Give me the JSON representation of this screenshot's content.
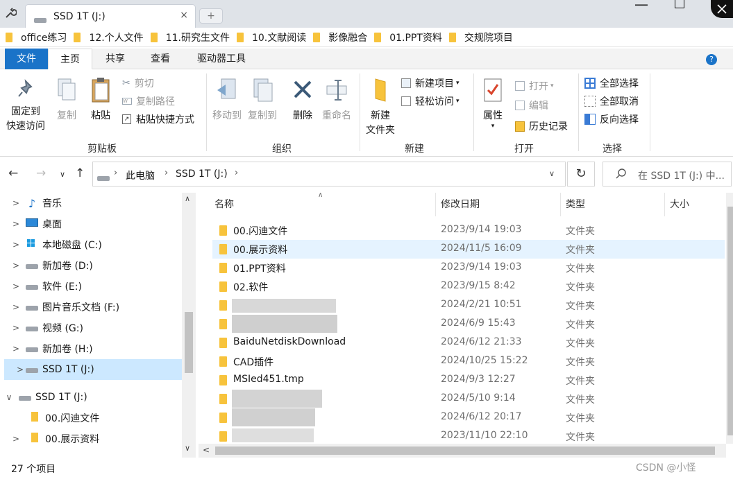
{
  "window": {
    "tab_title": "SSD 1T (J:)",
    "tab_close": "×",
    "new_tab": "+",
    "minimize": "—"
  },
  "bookmarks": [
    "office练习",
    "12.个人文件",
    "11.研究生文件",
    "10.文献阅读",
    "影像融合",
    "01.PPT资料",
    "交规院项目"
  ],
  "ribbon_tabs": {
    "file": "文件",
    "home": "主页",
    "share": "共享",
    "view": "查看",
    "drive_tools": "驱动器工具",
    "help": "?"
  },
  "ribbon": {
    "clipboard": {
      "title": "剪贴板",
      "pin_line1": "固定到",
      "pin_line2": "快速访问",
      "copy": "复制",
      "paste": "粘贴",
      "cut": "剪切",
      "copy_path": "复制路径",
      "paste_shortcut": "粘贴快捷方式"
    },
    "organize": {
      "title": "组织",
      "move_to": "移动到",
      "copy_to": "复制到",
      "delete": "删除",
      "rename": "重命名"
    },
    "new": {
      "title": "新建",
      "new_folder_line1": "新建",
      "new_folder_line2": "文件夹",
      "new_item": "新建项目",
      "easy_access": "轻松访问"
    },
    "open": {
      "title": "打开",
      "properties": "属性",
      "open": "打开",
      "edit": "编辑",
      "history": "历史记录"
    },
    "select": {
      "title": "选择",
      "select_all": "全部选择",
      "select_none": "全部取消",
      "invert": "反向选择"
    }
  },
  "address": {
    "crumb1": "此电脑",
    "crumb2": "SSD 1T (J:)",
    "search_placeholder": "在 SSD 1T (J:) 中..."
  },
  "nav_items": [
    {
      "label": "音乐",
      "icon": "music-icon"
    },
    {
      "label": "桌面",
      "icon": "desktop-icon"
    },
    {
      "label": "本地磁盘 (C:)",
      "icon": "windows-drive-icon"
    },
    {
      "label": "新加卷 (D:)",
      "icon": "drive-icon"
    },
    {
      "label": "软件 (E:)",
      "icon": "drive-icon"
    },
    {
      "label": "图片音乐文档 (F:)",
      "icon": "drive-icon"
    },
    {
      "label": "视频 (G:)",
      "icon": "drive-icon"
    },
    {
      "label": "新加卷 (H:)",
      "icon": "drive-icon"
    },
    {
      "label": "SSD 1T (J:)",
      "icon": "drive-icon",
      "selected": true
    }
  ],
  "nav_tree": {
    "root": "SSD 1T (J:)",
    "children": [
      "00.闪迪文件",
      "00.展示资料"
    ]
  },
  "columns": {
    "name": "名称",
    "modified": "修改日期",
    "type": "类型",
    "size": "大小"
  },
  "files": [
    {
      "name": "00.闪迪文件",
      "date": "2023/9/14 19:03",
      "type": "文件夹"
    },
    {
      "name": "00.展示资料",
      "date": "2024/11/5 16:09",
      "type": "文件夹",
      "hover": true
    },
    {
      "name": "01.PPT资料",
      "date": "2023/9/14 19:03",
      "type": "文件夹"
    },
    {
      "name": "02.软件",
      "date": "2023/9/15 8:42",
      "type": "文件夹"
    },
    {
      "name": "",
      "date": "2024/2/21 10:51",
      "type": "文件夹",
      "blurred": true
    },
    {
      "name": "",
      "date": "2024/6/9 15:43",
      "type": "文件夹",
      "blurred": true
    },
    {
      "name": "BaiduNetdiskDownload",
      "date": "2024/6/12 21:33",
      "type": "文件夹"
    },
    {
      "name": "CAD插件",
      "date": "2024/10/25 15:22",
      "type": "文件夹"
    },
    {
      "name": "MSIed451.tmp",
      "date": "2024/9/3 12:27",
      "type": "文件夹"
    },
    {
      "name": "",
      "date": "2024/5/10 9:14",
      "type": "文件夹",
      "blurred": true
    },
    {
      "name": "",
      "date": "2024/6/12 20:17",
      "type": "文件夹",
      "blurred": true
    },
    {
      "name": "",
      "date": "2023/11/10 22:10",
      "type": "文件夹",
      "blurred": true
    }
  ],
  "status": {
    "item_count": "27 个项目"
  },
  "watermark": "CSDN @小怪",
  "colors": {
    "accent": "#1a73c8",
    "selected_bg": "#cce8ff",
    "hover_bg": "#e5f3ff",
    "folder": "#f7c33c"
  }
}
